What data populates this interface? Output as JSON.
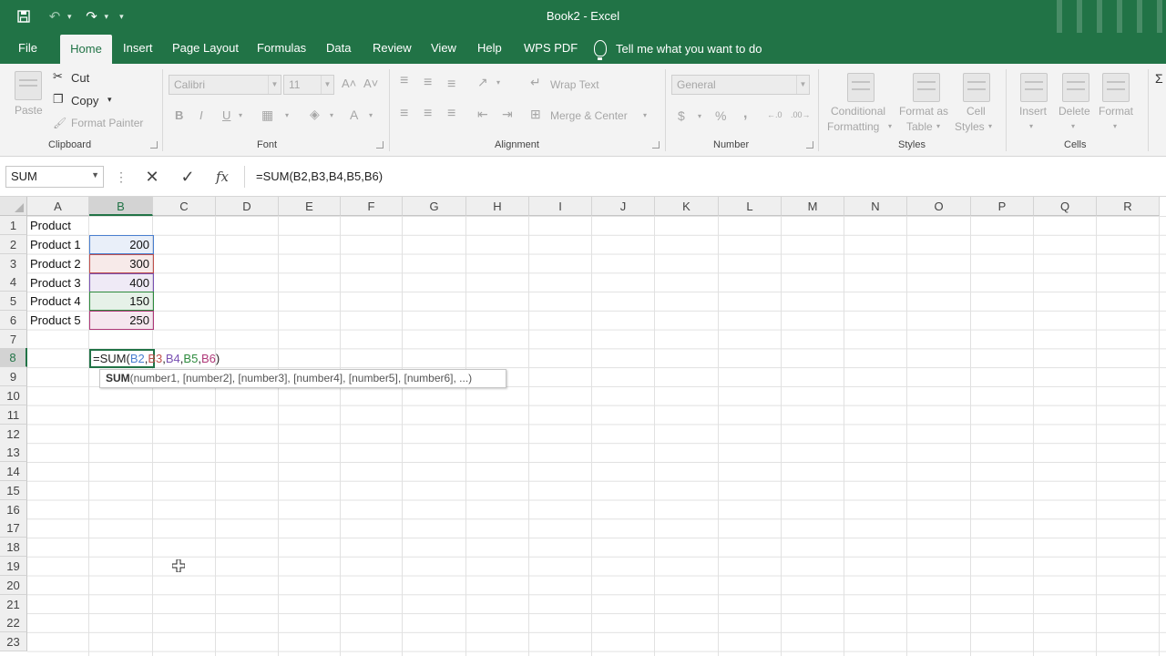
{
  "window": {
    "title": "Book2  -  Excel"
  },
  "qat": {
    "more": "▾"
  },
  "tabs": [
    {
      "label": "File"
    },
    {
      "label": "Home"
    },
    {
      "label": "Insert"
    },
    {
      "label": "Page Layout"
    },
    {
      "label": "Formulas"
    },
    {
      "label": "Data"
    },
    {
      "label": "Review"
    },
    {
      "label": "View"
    },
    {
      "label": "Help"
    },
    {
      "label": "WPS PDF"
    }
  ],
  "tellme": "Tell me what you want to do",
  "ribbon": {
    "clipboard": {
      "label": "Clipboard",
      "paste": "Paste",
      "cut": "Cut",
      "copy": "Copy",
      "format_painter": "Format Painter"
    },
    "font": {
      "label": "Font",
      "name": "Calibri",
      "size": "11",
      "bold": "B",
      "italic": "I",
      "underline": "U",
      "grow": "A˄",
      "shrink": "A˅",
      "color": "A"
    },
    "alignment": {
      "label": "Alignment",
      "wrap": "Wrap Text",
      "merge": "Merge & Center"
    },
    "number": {
      "label": "Number",
      "format": "General",
      "currency": "$",
      "percent": "%",
      "comma": ",",
      "inc": "←.0",
      "dec": ".00→"
    },
    "styles": {
      "label": "Styles",
      "conditional_1": "Conditional",
      "conditional_2": "Formatting",
      "format_as_1": "Format as",
      "format_as_2": "Table",
      "cell_1": "Cell",
      "cell_2": "Styles"
    },
    "cells": {
      "label": "Cells",
      "insert": "Insert",
      "delete": "Delete",
      "format": "Format"
    }
  },
  "formula_bar": {
    "name_box": "SUM",
    "formula": "=SUM(B2,B3,B4,B5,B6)",
    "cancel": "✕",
    "enter": "✓",
    "fx": "fx"
  },
  "columns": [
    "A",
    "B",
    "C",
    "D",
    "E",
    "F",
    "G",
    "H",
    "I",
    "J",
    "K",
    "L",
    "M",
    "N",
    "O",
    "P",
    "Q",
    "R"
  ],
  "rows": [
    "1",
    "2",
    "3",
    "4",
    "5",
    "6",
    "7",
    "8",
    "9",
    "10",
    "11",
    "12",
    "13",
    "14",
    "15",
    "16",
    "17",
    "18",
    "19",
    "20",
    "21",
    "22",
    "23"
  ],
  "cells": {
    "A1": "Product",
    "A2": "Product 1",
    "B2": "200",
    "A3": "Product 2",
    "B3": "300",
    "A4": "Product 3",
    "B4": "400",
    "A5": "Product 4",
    "B5": "150",
    "A6": "Product 5",
    "B6": "250"
  },
  "edit": {
    "prefix": "=SUM",
    "open": "(",
    "r1": "B2",
    "r2": "B3",
    "r3": "B4",
    "r4": "B5",
    "r5": "B6",
    "close": ")",
    "comma": ","
  },
  "tooltip": {
    "fn": "SUM",
    "args": "(number1, [number2], [number3], [number4], [number5], [number6], ...)"
  },
  "colors": {
    "accent": "#217346",
    "ref1": "#4a7fd0",
    "ref2": "#c0504d",
    "ref3": "#7a52b3",
    "ref4": "#2e8b3e",
    "ref5": "#b03a7a"
  }
}
